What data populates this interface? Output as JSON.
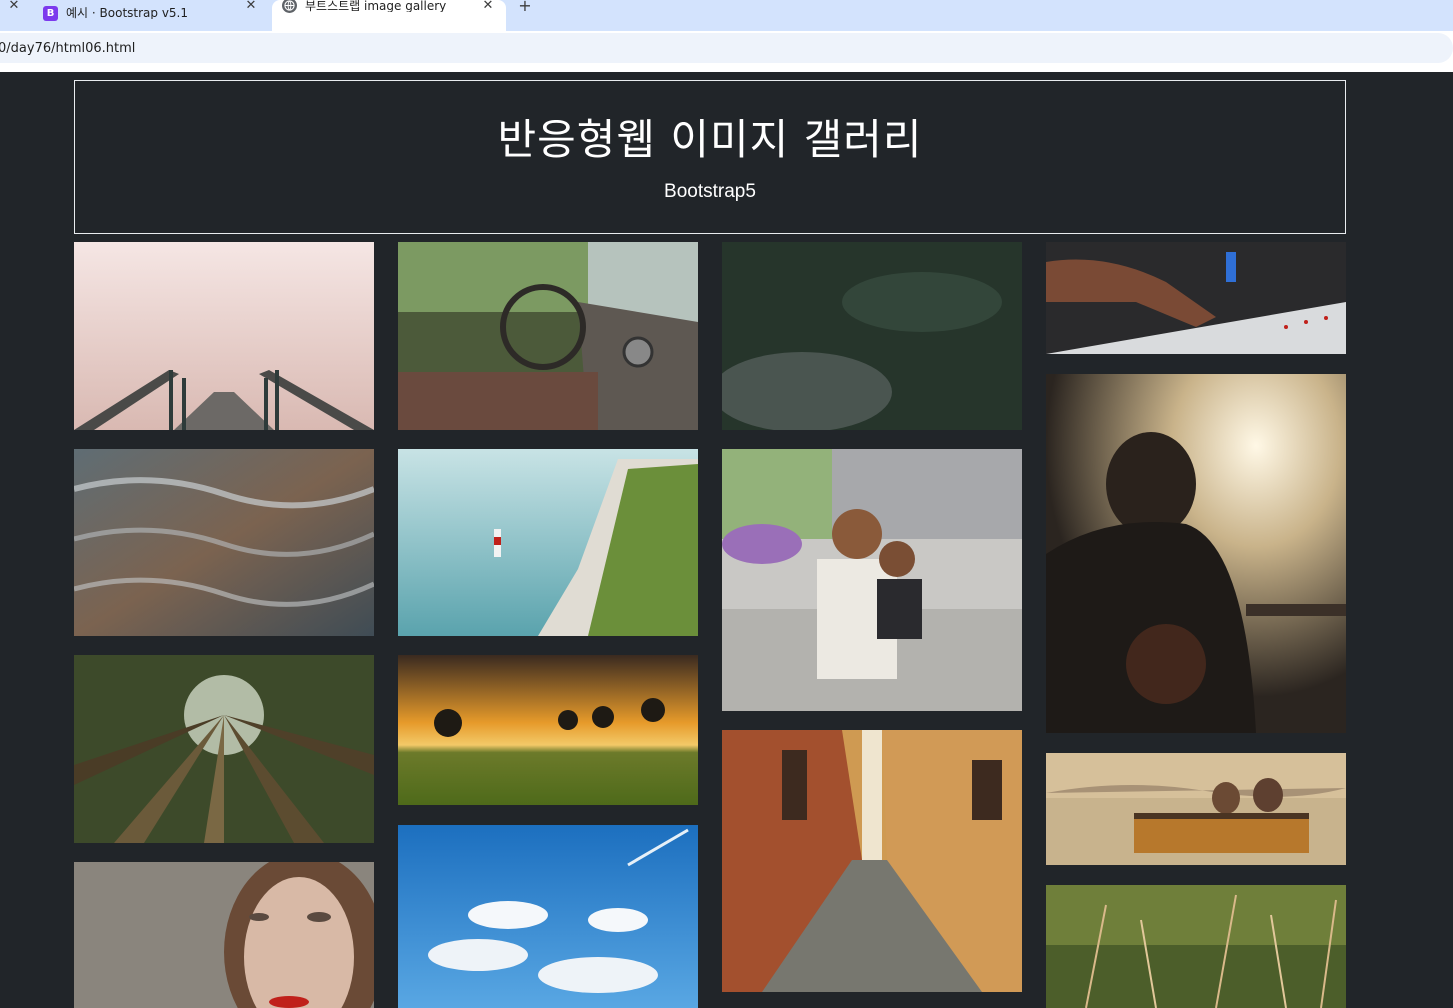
{
  "browser": {
    "tabs": [
      {
        "title": "예시 · Bootstrap v5.1",
        "favicon": "bootstrap-icon"
      },
      {
        "title": "부트스트랩 image gallery",
        "favicon": "globe-icon"
      }
    ],
    "close_glyph": "✕",
    "new_tab_glyph": "+",
    "url": "0/day76/html06.html"
  },
  "header": {
    "title": "반응형웹 이미지 갤러리",
    "subtitle": "Bootstrap5"
  },
  "gallery": {
    "columns": 4,
    "images": [
      {
        "name": "misty-stairs-photo",
        "col": 1
      },
      {
        "name": "abandoned-truck-interior-photo",
        "col": 2
      },
      {
        "name": "pine-forest-aerial-photo",
        "col": 3
      },
      {
        "name": "mixing-console-hand-photo",
        "col": 4
      },
      {
        "name": "rippled-water-photo",
        "col": 1
      },
      {
        "name": "lighthouse-cliff-photo",
        "col": 2
      },
      {
        "name": "mother-child-street-photo",
        "col": 3
      },
      {
        "name": "man-sunset-backlit-photo",
        "col": 4
      },
      {
        "name": "tall-trees-looking-up-photo",
        "col": 1
      },
      {
        "name": "sunset-field-trees-photo",
        "col": 2
      },
      {
        "name": "narrow-alley-cobblestone-photo",
        "col": 3
      },
      {
        "name": "couple-bench-sea-photo",
        "col": 4
      },
      {
        "name": "woman-portrait-photo",
        "col": 1
      },
      {
        "name": "blue-sky-clouds-photo",
        "col": 2
      },
      {
        "name": "grass-golden-light-photo",
        "col": 4
      }
    ]
  },
  "colors": {
    "page_background": "#212529",
    "tab_strip": "#d3e3fd",
    "header_border": "#e9ecef",
    "text": "#ffffff"
  }
}
